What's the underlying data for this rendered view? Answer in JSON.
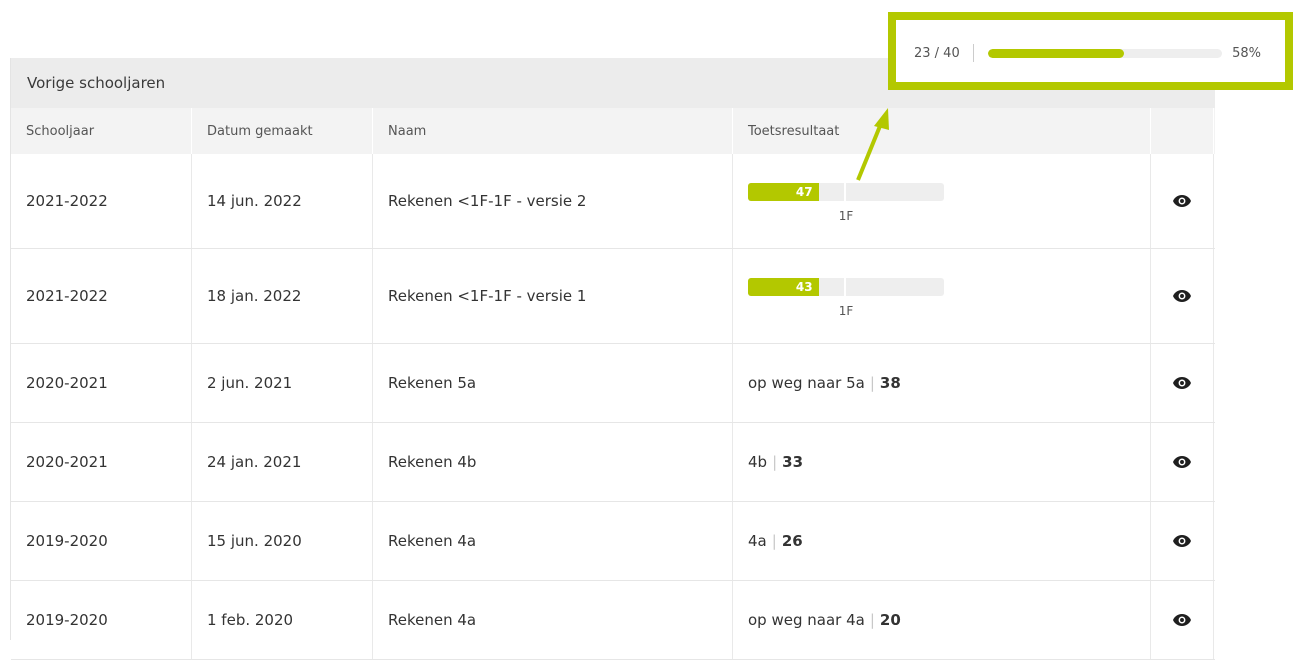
{
  "panel": {
    "title": "Vorige schooljaren",
    "columns": [
      "Schooljaar",
      "Datum gemaakt",
      "Naam",
      "Toetsresultaat",
      ""
    ]
  },
  "rows": [
    {
      "year": "2021-2022",
      "date": "14 jun. 2022",
      "name": "Rekenen <1F-1F - versie 2",
      "result_type": "bar",
      "score": "47",
      "bar_fraction": 0.36,
      "level": "1F",
      "action_icon": "eye-icon"
    },
    {
      "year": "2021-2022",
      "date": "18 jan. 2022",
      "name": "Rekenen <1F-1F - versie 1",
      "result_type": "bar",
      "score": "43",
      "bar_fraction": 0.36,
      "level": "1F",
      "action_icon": "eye-icon"
    },
    {
      "year": "2020-2021",
      "date": "2 jun. 2021",
      "name": "Rekenen 5a",
      "result_type": "text",
      "level": "op weg naar 5a",
      "score": "38",
      "action_icon": "eye-icon"
    },
    {
      "year": "2020-2021",
      "date": "24 jan. 2021",
      "name": "Rekenen 4b",
      "result_type": "text",
      "level": "4b",
      "score": "33",
      "action_icon": "eye-icon"
    },
    {
      "year": "2019-2020",
      "date": "15 jun. 2020",
      "name": "Rekenen 4a",
      "result_type": "text",
      "level": "4a",
      "score": "26",
      "action_icon": "eye-icon"
    },
    {
      "year": "2019-2020",
      "date": "1 feb. 2020",
      "name": "Rekenen 4a",
      "result_type": "text",
      "level": "op weg naar 4a",
      "score": "20",
      "action_icon": "eye-icon"
    }
  ],
  "progress": {
    "count": "23 / 40",
    "percent_label": "58%",
    "fraction": 0.58
  },
  "colors": {
    "accent": "#b3c800",
    "header_bg": "#ececec",
    "subheader_bg": "#f3f3f3"
  }
}
